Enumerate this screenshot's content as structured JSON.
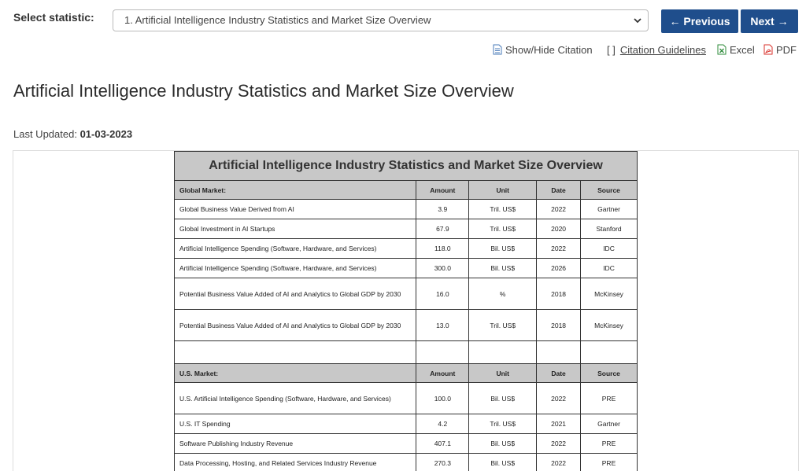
{
  "header": {
    "select_label": "Select statistic:",
    "selected_statistic": "1. Artificial Intelligence Industry Statistics and Market Size Overview",
    "previous_label": "← Previous",
    "next_label": "Next →"
  },
  "tools": {
    "citation_toggle": "Show/Hide Citation",
    "citation_guidelines": "Citation Guidelines",
    "citation_brackets": "[ ]",
    "excel": "Excel",
    "pdf": "PDF"
  },
  "page": {
    "title": "Artificial Intelligence Industry Statistics and Market Size Overview",
    "last_updated_label": "Last Updated:",
    "last_updated_value": "01-03-2023"
  },
  "table": {
    "title": "Artificial Intelligence Industry Statistics and Market Size Overview",
    "global": {
      "headers": [
        "Global Market:",
        "Amount",
        "Unit",
        "Date",
        "Source"
      ],
      "rows": [
        [
          "Global Business Value Derived from AI",
          "3.9",
          "Tril. US$",
          "2022",
          "Gartner"
        ],
        [
          "Global Investment in AI Startups",
          "67.9",
          "Tril. US$",
          "2020",
          "Stanford"
        ],
        [
          "Artificial Intelligence Spending (Software, Hardware, and Services)",
          "118.0",
          "Bil. US$",
          "2022",
          "IDC"
        ],
        [
          "Artificial Intelligence Spending (Software, Hardware, and Services)",
          "300.0",
          "Bil. US$",
          "2026",
          "IDC"
        ],
        [
          "Potential Business Value Added of AI and Analytics to Global GDP by 2030",
          "16.0",
          "%",
          "2018",
          "McKinsey"
        ],
        [
          "Potential Business Value Added of AI and Analytics to Global GDP  by 2030",
          "13.0",
          "Tril. US$",
          "2018",
          "McKinsey"
        ]
      ]
    },
    "us": {
      "headers": [
        "U.S. Market:",
        "Amount",
        "Unit",
        "Date",
        "Source"
      ],
      "rows": [
        [
          "U.S. Artificial Intelligence Spending (Software, Hardware, and Services)",
          "100.0",
          "Bil. US$",
          "2022",
          "PRE"
        ],
        [
          "U.S. IT Spending",
          "4.2",
          "Tril. US$",
          "2021",
          "Gartner"
        ],
        [
          "Software Publishing Industry Revenue",
          "407.1",
          "Bil. US$",
          "2022",
          "PRE"
        ],
        [
          "Data Processing, Hosting, and Related Services Industry Revenue",
          "270.3",
          "Bil. US$",
          "2022",
          "PRE"
        ]
      ]
    }
  },
  "colors": {
    "nav_button": "#1f4e8c",
    "table_header": "#c8c8c8",
    "excel_icon": "#2e8b3a",
    "pdf_icon": "#d9322b",
    "doc_icon": "#4a7bb8"
  }
}
